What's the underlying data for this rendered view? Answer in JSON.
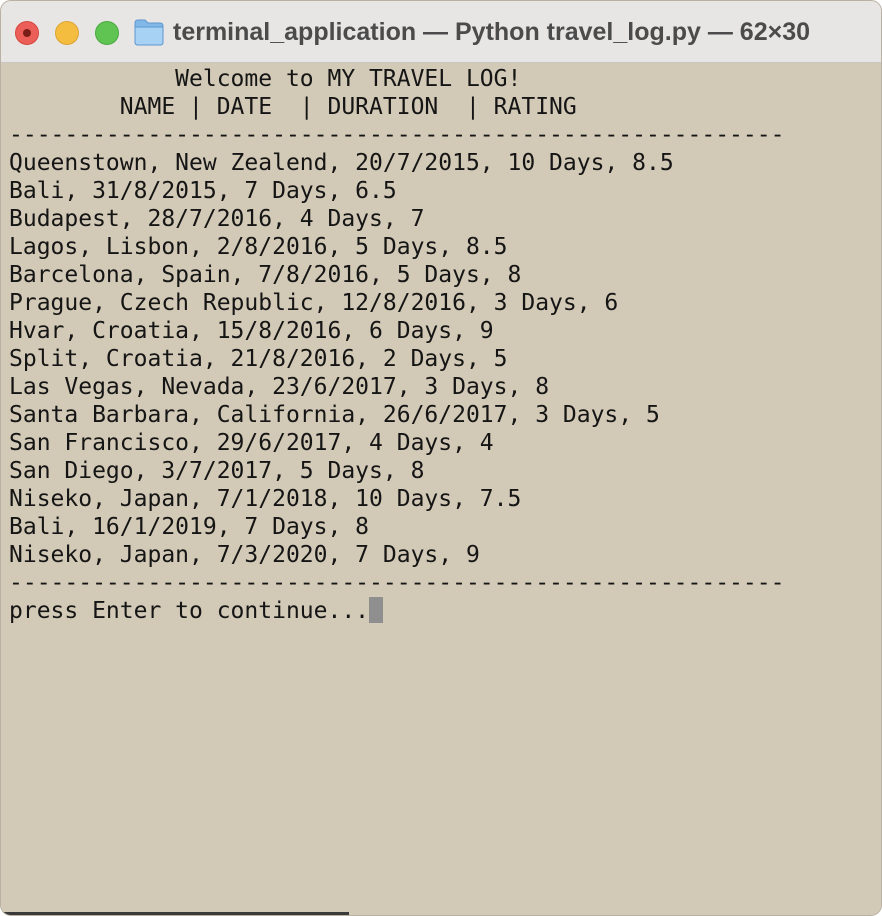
{
  "window": {
    "title": "terminal_application — Python travel_log.py — 62×30",
    "icon": "folder-icon",
    "buttons": [
      "close",
      "minimize",
      "zoom"
    ]
  },
  "colors": {
    "terminal_background": "#d2c9b6",
    "text": "#151515",
    "cursor": "#8f8f8f",
    "close": "#ec5f58",
    "minimize": "#f4bd40",
    "zoom": "#5fc452"
  },
  "terminal": {
    "welcome": "            Welcome to MY TRAVEL LOG!",
    "header": "        NAME | DATE  | DURATION  | RATING",
    "divider": "--------------------------------------------------------",
    "entries": [
      "Queenstown, New Zealend, 20/7/2015, 10 Days, 8.5",
      "Bali, 31/8/2015, 7 Days, 6.5",
      "Budapest, 28/7/2016, 4 Days, 7",
      "Lagos, Lisbon, 2/8/2016, 5 Days, 8.5",
      "Barcelona, Spain, 7/8/2016, 5 Days, 8",
      "Prague, Czech Republic, 12/8/2016, 3 Days, 6",
      "Hvar, Croatia, 15/8/2016, 6 Days, 9",
      "Split, Croatia, 21/8/2016, 2 Days, 5",
      "Las Vegas, Nevada, 23/6/2017, 3 Days, 8",
      "Santa Barbara, California, 26/6/2017, 3 Days, 5",
      "San Francisco, 29/6/2017, 4 Days, 4",
      "San Diego, 3/7/2017, 5 Days, 8",
      "Niseko, Japan, 7/1/2018, 10 Days, 7.5",
      "Bali, 16/1/2019, 7 Days, 8",
      "Niseko, Japan, 7/3/2020, 7 Days, 9"
    ],
    "prompt": "press Enter to continue..."
  }
}
